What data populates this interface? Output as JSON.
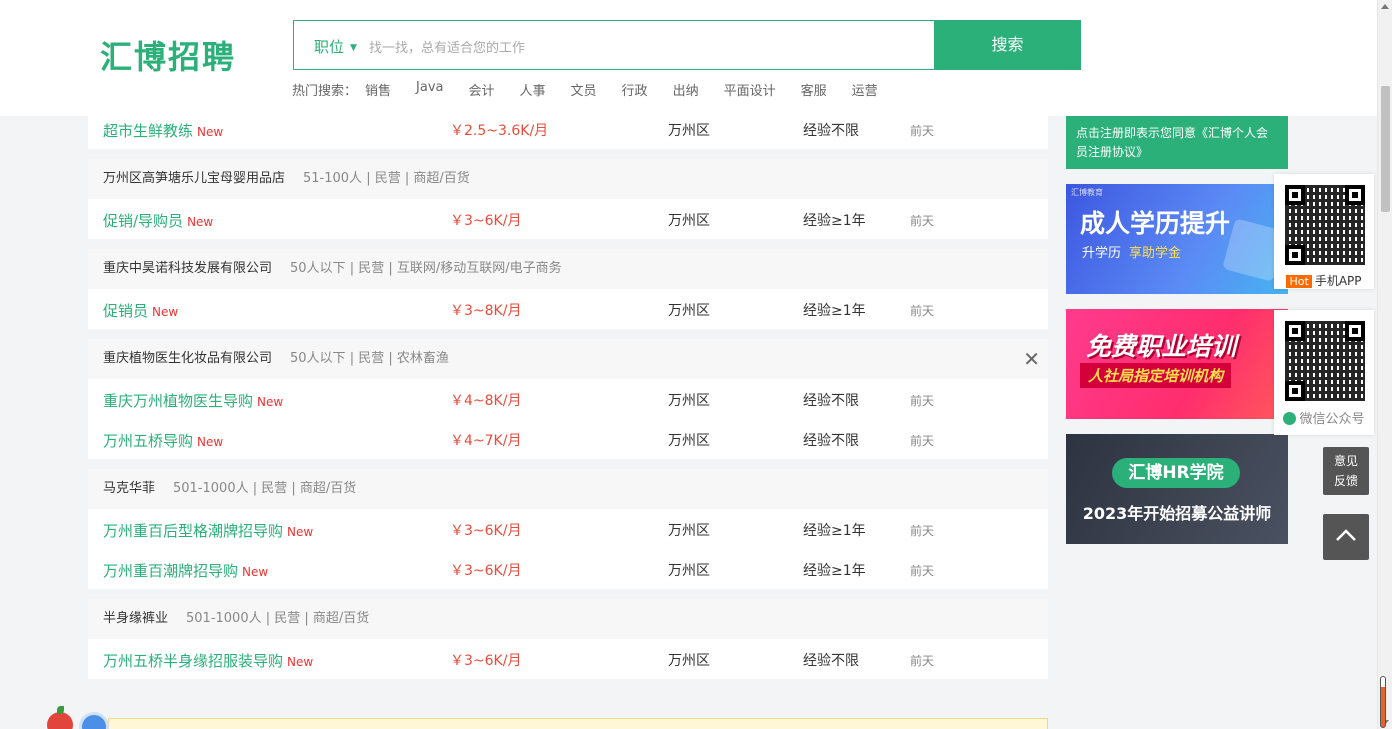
{
  "header": {
    "logo": "汇博招聘",
    "search_category": "职位",
    "search_placeholder": "找一找，总有适合您的工作",
    "search_button": "搜索",
    "hot_label": "热门搜索：",
    "hot_keywords": [
      "销售",
      "Java",
      "会计",
      "人事",
      "文员",
      "行政",
      "出纳",
      "平面设计",
      "客服",
      "运营"
    ]
  },
  "companies": [
    {
      "name": "",
      "info": "",
      "jobs": [
        {
          "title": "超市生鲜教练",
          "new": "New",
          "salary": "￥2.5~3.6K/月",
          "area": "万州区",
          "exp": "经验不限",
          "time": "前天"
        }
      ]
    },
    {
      "name": "万州区高笋塘乐儿宝母婴用品店",
      "info": "51-100人 | 民营 | 商超/百货",
      "jobs": [
        {
          "title": "促销/导购员",
          "new": "New",
          "salary": "￥3~6K/月",
          "area": "万州区",
          "exp": "经验≥1年",
          "time": "前天"
        }
      ]
    },
    {
      "name": "重庆中昊诺科技发展有限公司",
      "info": "50人以下 | 民营 | 互联网/移动互联网/电子商务",
      "jobs": [
        {
          "title": "促销员",
          "new": "New",
          "salary": "￥3~8K/月",
          "area": "万州区",
          "exp": "经验≥1年",
          "time": "前天"
        }
      ]
    },
    {
      "name": "重庆植物医生化妆品有限公司",
      "info": "50人以下 | 民营 | 农林畜渔",
      "close": "✕",
      "jobs": [
        {
          "title": "重庆万州植物医生导购",
          "new": "New",
          "salary": "￥4~8K/月",
          "area": "万州区",
          "exp": "经验不限",
          "time": "前天"
        },
        {
          "title": "万州五桥导购",
          "new": "New",
          "salary": "￥4~7K/月",
          "area": "万州区",
          "exp": "经验不限",
          "time": "前天"
        }
      ]
    },
    {
      "name": "马克华菲",
      "info": "501-1000人 | 民营 | 商超/百货",
      "jobs": [
        {
          "title": "万州重百后型格潮牌招导购",
          "new": "New",
          "salary": "￥3~6K/月",
          "area": "万州区",
          "exp": "经验≥1年",
          "time": "前天"
        },
        {
          "title": "万州重百潮牌招导购",
          "new": "New",
          "salary": "￥3~6K/月",
          "area": "万州区",
          "exp": "经验≥1年",
          "time": "前天"
        }
      ]
    },
    {
      "name": "半身缘裤业",
      "info": "501-1000人 | 民营 | 商超/百货",
      "jobs": [
        {
          "title": "万州五桥半身缘招服装导购",
          "new": "New",
          "salary": "￥3~6K/月",
          "area": "万州区",
          "exp": "经验不限",
          "time": "前天"
        }
      ]
    }
  ],
  "sidebar": {
    "register_note": "点击注册即表示您同意《汇博个人会员注册协议》",
    "banner1": {
      "small": "汇博教育",
      "title": "成人学历提升",
      "sub": "升学历",
      "highlight": "享助学金"
    },
    "banner2": {
      "title": "免费职业培训",
      "sub": "人社局指定培训机构"
    },
    "banner3": {
      "badge": "汇博HR学院",
      "sub": "2023年开始招募公益讲师"
    },
    "qr_app": {
      "tag": "Hot",
      "label": "手机APP"
    },
    "qr_wechat": {
      "label": "微信公众号"
    },
    "feedback": [
      "意见",
      "反馈"
    ]
  },
  "colors": {
    "brand": "#2bb07a",
    "salary": "#e84c3d",
    "new": "#e33"
  }
}
